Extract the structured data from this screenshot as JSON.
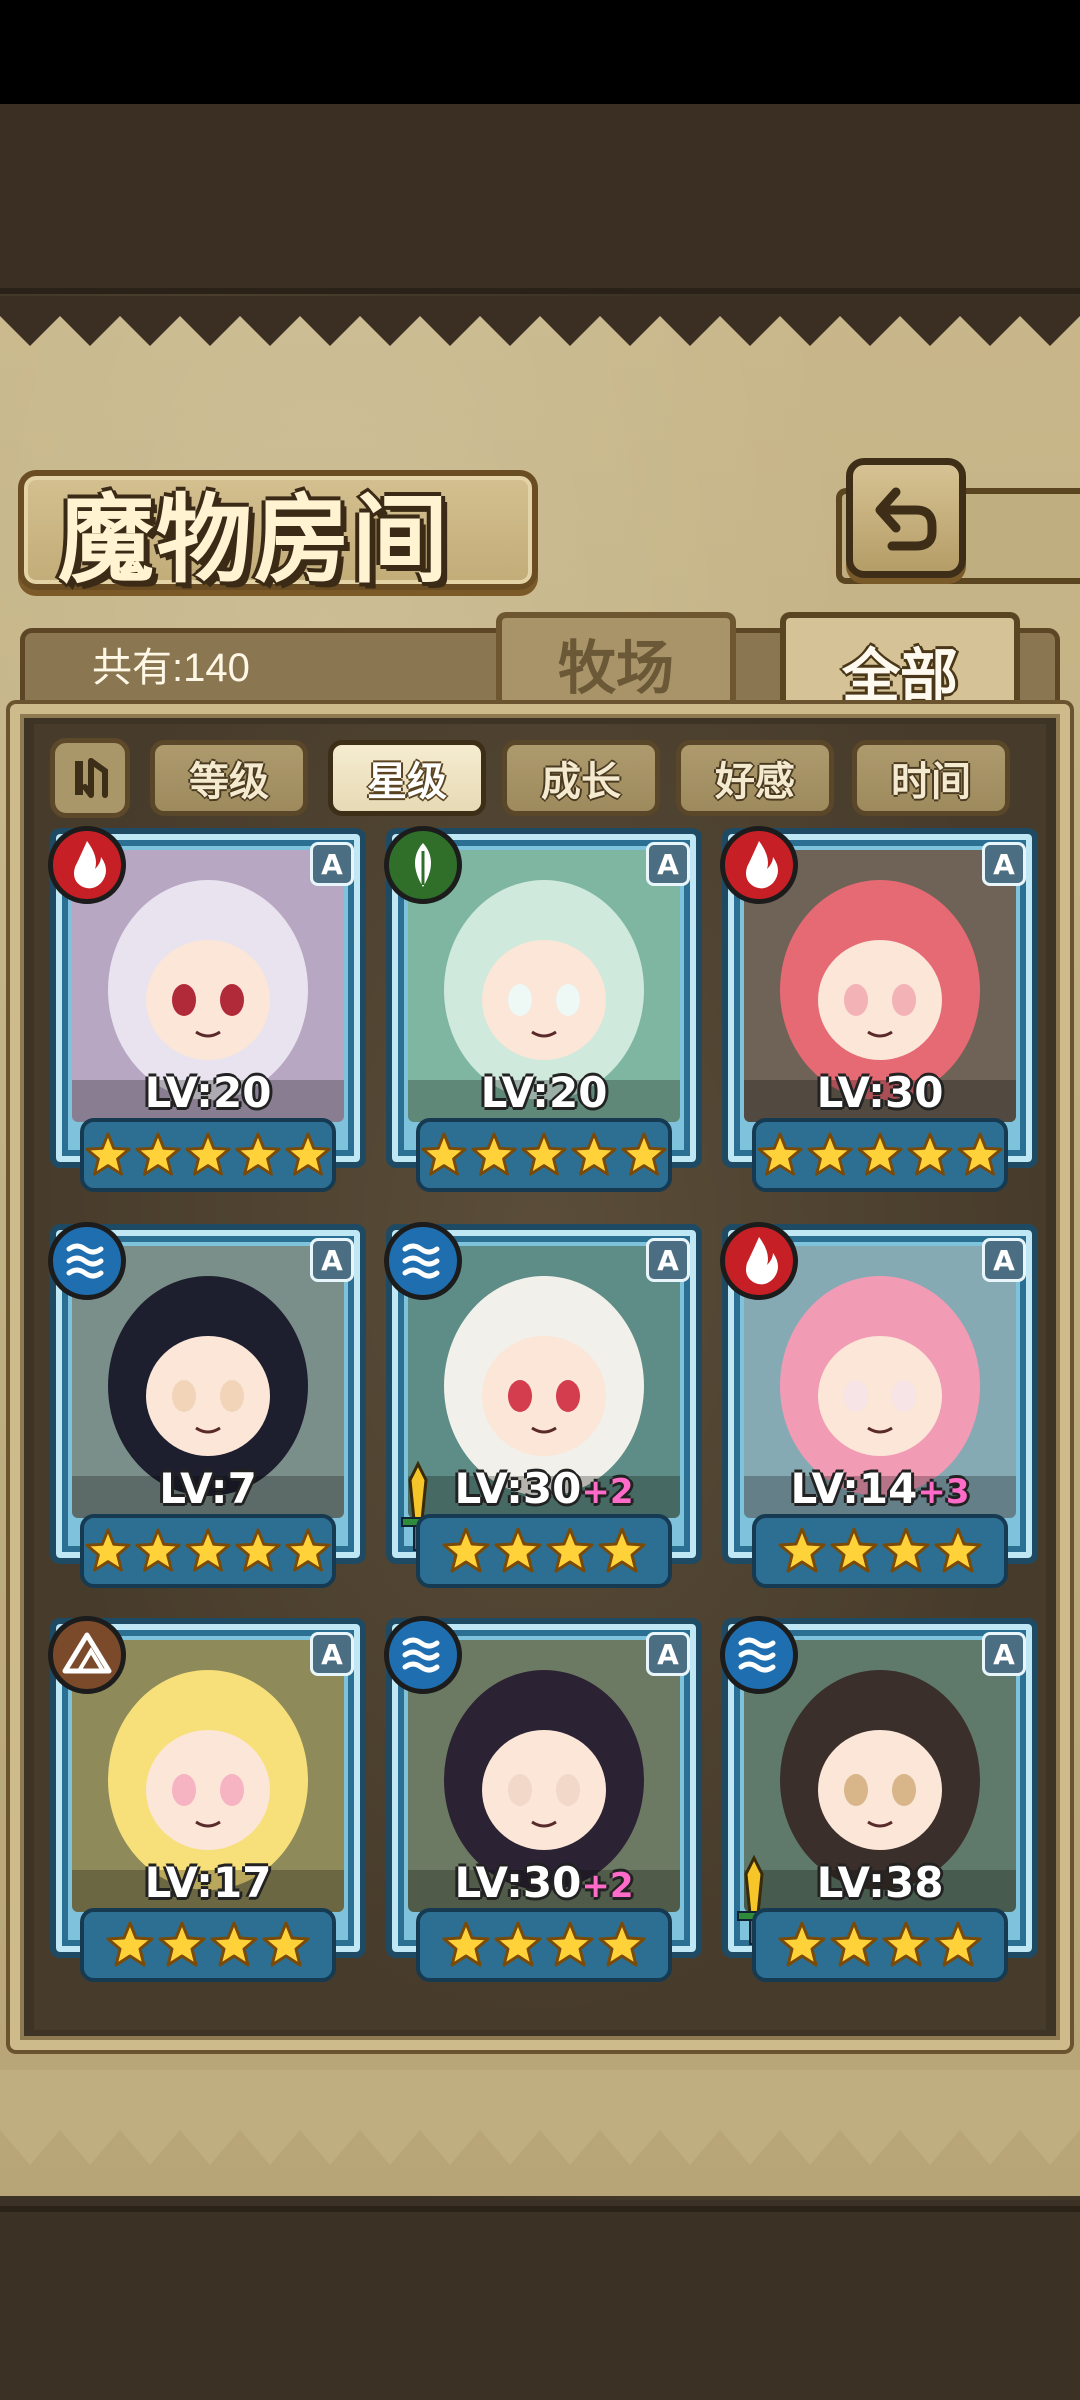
{
  "title": "魔物房间",
  "count_text": "共有:140",
  "tabs": {
    "ranch": "牧场",
    "all": "全部"
  },
  "sort": {
    "buttons": [
      "等级",
      "星级",
      "成长",
      "好感",
      "时间"
    ],
    "active": "星级"
  },
  "colors": {
    "fire": "#c62026",
    "grass": "#2f6f2a",
    "water": "#1f6fb0",
    "earth": "#7a4a2a"
  },
  "monsters": [
    {
      "level": "LV:20",
      "plus": "",
      "element": "fire-icon",
      "rank": "A",
      "stars": 5
    },
    {
      "level": "LV:20",
      "plus": "",
      "element": "grass-icon",
      "rank": "A",
      "stars": 5
    },
    {
      "level": "LV:30",
      "plus": "",
      "element": "fire-icon",
      "rank": "A",
      "stars": 5
    },
    {
      "level": "LV:7",
      "plus": "",
      "element": "water-icon",
      "rank": "A",
      "stars": 5
    },
    {
      "level": "LV:30",
      "plus": "+2",
      "element": "water-icon",
      "rank": "A",
      "stars": 4
    },
    {
      "level": "LV:14",
      "plus": "+3",
      "element": "fire-icon",
      "rank": "A",
      "stars": 4
    },
    {
      "level": "LV:17",
      "plus": "",
      "element": "earth-icon",
      "rank": "A",
      "stars": 4
    },
    {
      "level": "LV:30",
      "plus": "+2",
      "element": "water-icon",
      "rank": "A",
      "stars": 4
    },
    {
      "level": "LV:38",
      "plus": "",
      "element": "water-icon",
      "rank": "A",
      "stars": 4
    }
  ]
}
